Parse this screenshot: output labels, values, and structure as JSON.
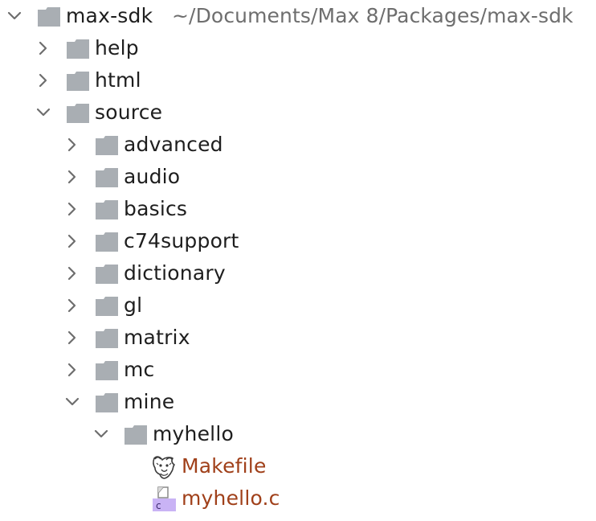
{
  "tree": {
    "root": {
      "label": "max-sdk",
      "path": "~/Documents/Max 8/Packages/max-sdk",
      "expanded": true,
      "icon": "folder-icon"
    },
    "items": [
      {
        "label": "help",
        "expanded": false,
        "icon": "folder-icon"
      },
      {
        "label": "html",
        "expanded": false,
        "icon": "folder-icon"
      },
      {
        "label": "source",
        "expanded": true,
        "icon": "folder-icon"
      },
      {
        "label": "advanced",
        "expanded": false,
        "icon": "folder-icon"
      },
      {
        "label": "audio",
        "expanded": false,
        "icon": "folder-icon"
      },
      {
        "label": "basics",
        "expanded": false,
        "icon": "folder-icon"
      },
      {
        "label": "c74support",
        "expanded": false,
        "icon": "folder-icon"
      },
      {
        "label": "dictionary",
        "expanded": false,
        "icon": "folder-icon"
      },
      {
        "label": "gl",
        "expanded": false,
        "icon": "folder-icon"
      },
      {
        "label": "matrix",
        "expanded": false,
        "icon": "folder-icon"
      },
      {
        "label": "mc",
        "expanded": false,
        "icon": "folder-icon"
      },
      {
        "label": "mine",
        "expanded": true,
        "icon": "folder-icon"
      },
      {
        "label": "myhello",
        "expanded": true,
        "icon": "folder-icon"
      },
      {
        "label": "Makefile",
        "icon": "gnu-makefile-icon"
      },
      {
        "label": "myhello.c",
        "icon": "c-file-icon",
        "badge": "c"
      }
    ]
  },
  "colors": {
    "folder": "#a9aeb3",
    "chevron": "#6e6e6e",
    "text": "#1e1e1e",
    "path": "#6e6e6e",
    "modified_file": "#a0401a",
    "c_badge": "#c9b3f5"
  }
}
